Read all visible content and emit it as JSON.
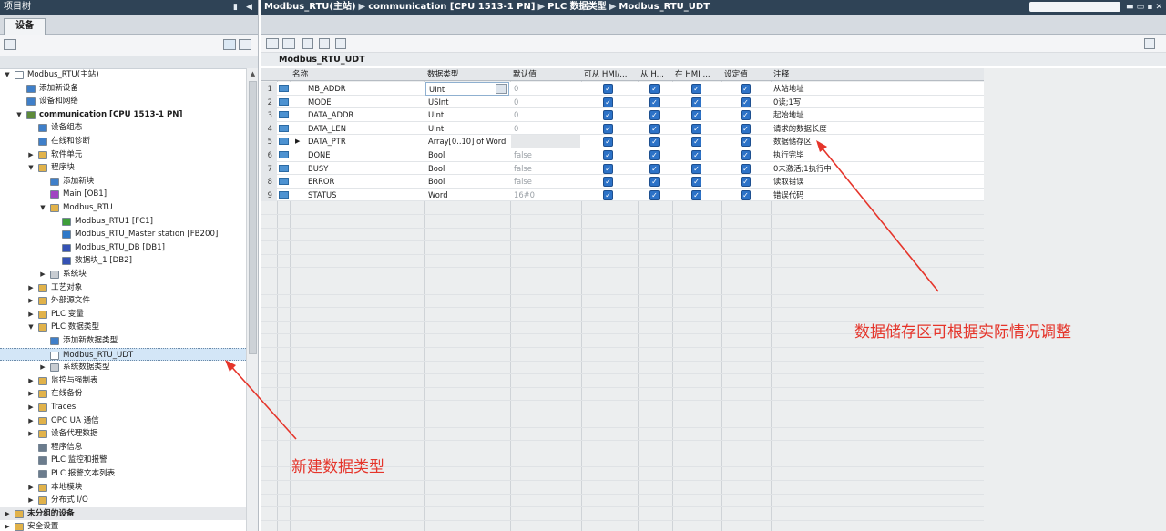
{
  "left_panel": {
    "title": "项目树",
    "tab": "设备"
  },
  "tree": [
    {
      "label": "Modbus_RTU(主站)",
      "level": 0,
      "arrow": "▼",
      "icon": "project-icon",
      "color": "#ffffff"
    },
    {
      "label": "添加新设备",
      "level": 1,
      "arrow": "",
      "icon": "add-device-icon",
      "color": "#3f7fc9"
    },
    {
      "label": "设备和网络",
      "level": 1,
      "arrow": "",
      "icon": "network-icon",
      "color": "#3f7fc9"
    },
    {
      "label": "communication [CPU 1513-1 PN]",
      "level": 1,
      "arrow": "▼",
      "icon": "cpu-icon",
      "color": "#5d8a3a",
      "bold": true
    },
    {
      "label": "设备组态",
      "level": 2,
      "arrow": "",
      "icon": "config-icon",
      "color": "#3f7fc9"
    },
    {
      "label": "在线和诊断",
      "level": 2,
      "arrow": "",
      "icon": "diagnostics-icon",
      "color": "#3f7fc9"
    },
    {
      "label": "软件单元",
      "level": 2,
      "arrow": "▶",
      "icon": "folder-icon",
      "color": "#e1b24a"
    },
    {
      "label": "程序块",
      "level": 2,
      "arrow": "▼",
      "icon": "folder-icon",
      "color": "#e1b24a"
    },
    {
      "label": "添加新块",
      "level": 3,
      "arrow": "",
      "icon": "add-block-icon",
      "color": "#3f7fc9"
    },
    {
      "label": "Main [OB1]",
      "level": 3,
      "arrow": "",
      "icon": "ob-icon",
      "color": "#a044c2"
    },
    {
      "label": "Modbus_RTU",
      "level": 3,
      "arrow": "▼",
      "icon": "folder-icon",
      "color": "#e1b24a"
    },
    {
      "label": "Modbus_RTU1 [FC1]",
      "level": 4,
      "arrow": "",
      "icon": "fc-icon",
      "color": "#3e9e3a"
    },
    {
      "label": "Modbus_RTU_Master station [FB200]",
      "level": 4,
      "arrow": "",
      "icon": "fb-icon",
      "color": "#2e78c8"
    },
    {
      "label": "Modbus_RTU_DB [DB1]",
      "level": 4,
      "arrow": "",
      "icon": "db-icon",
      "color": "#3552b5"
    },
    {
      "label": "数据块_1 [DB2]",
      "level": 4,
      "arrow": "",
      "icon": "db-icon",
      "color": "#3552b5"
    },
    {
      "label": "系统块",
      "level": 3,
      "arrow": "▶",
      "icon": "folder-icon",
      "color": "#c7ccd2"
    },
    {
      "label": "工艺对象",
      "level": 2,
      "arrow": "▶",
      "icon": "folder-icon",
      "color": "#e1b24a"
    },
    {
      "label": "外部源文件",
      "level": 2,
      "arrow": "▶",
      "icon": "folder-icon",
      "color": "#e1b24a"
    },
    {
      "label": "PLC 变量",
      "level": 2,
      "arrow": "▶",
      "icon": "folder-icon",
      "color": "#e1b24a"
    },
    {
      "label": "PLC 数据类型",
      "level": 2,
      "arrow": "▼",
      "icon": "folder-icon",
      "color": "#e1b24a"
    },
    {
      "label": "添加新数据类型",
      "level": 3,
      "arrow": "",
      "icon": "add-type-icon",
      "color": "#3f7fc9"
    },
    {
      "label": "Modbus_RTU_UDT",
      "level": 3,
      "arrow": "",
      "icon": "udt-icon",
      "color": "#ffffff",
      "selected": true
    },
    {
      "label": "系统数据类型",
      "level": 3,
      "arrow": "▶",
      "icon": "folder-icon",
      "color": "#c7ccd2"
    },
    {
      "label": "监控与强制表",
      "level": 2,
      "arrow": "▶",
      "icon": "folder-icon",
      "color": "#e1b24a"
    },
    {
      "label": "在线备份",
      "level": 2,
      "arrow": "▶",
      "icon": "folder-icon",
      "color": "#e1b24a"
    },
    {
      "label": "Traces",
      "level": 2,
      "arrow": "▶",
      "icon": "folder-icon",
      "color": "#e1b24a"
    },
    {
      "label": "OPC UA 通信",
      "level": 2,
      "arrow": "▶",
      "icon": "folder-icon",
      "color": "#e1b24a"
    },
    {
      "label": "设备代理数据",
      "level": 2,
      "arrow": "▶",
      "icon": "folder-icon",
      "color": "#e1b24a"
    },
    {
      "label": "程序信息",
      "level": 2,
      "arrow": "",
      "icon": "info-icon",
      "color": "#6b7c8d"
    },
    {
      "label": "PLC 监控和报警",
      "level": 2,
      "arrow": "",
      "icon": "alarm-icon",
      "color": "#6b7c8d"
    },
    {
      "label": "PLC 报警文本列表",
      "level": 2,
      "arrow": "",
      "icon": "text-list-icon",
      "color": "#6b7c8d"
    },
    {
      "label": "本地模块",
      "level": 2,
      "arrow": "▶",
      "icon": "folder-icon",
      "color": "#e1b24a"
    },
    {
      "label": "分布式 I/O",
      "level": 2,
      "arrow": "▶",
      "icon": "folder-icon",
      "color": "#e1b24a"
    },
    {
      "label": "未分组的设备",
      "level": 0,
      "arrow": "▶",
      "icon": "folder-icon",
      "color": "#e1b24a",
      "bold": true,
      "gray": true
    },
    {
      "label": "安全设置",
      "level": 0,
      "arrow": "▶",
      "icon": "folder-icon",
      "color": "#e1b24a"
    }
  ],
  "breadcrumb": [
    "Modbus_RTU(主站)",
    "communication [CPU 1513-1 PN]",
    "PLC 数据类型",
    "Modbus_RTU_UDT"
  ],
  "editor": {
    "udt_name": "Modbus_RTU_UDT",
    "columns": [
      "名称",
      "数据类型",
      "默认值",
      "可从 HMI/...",
      "从 H...",
      "在 HMI ...",
      "设定值",
      "注释"
    ],
    "rows": [
      {
        "num": "1",
        "name": "MB_ADDR",
        "type": "UInt",
        "default": "0",
        "hmi1": true,
        "hmi2": true,
        "hmi3": true,
        "setpoint": true,
        "comment": "从站地址",
        "editing": true
      },
      {
        "num": "2",
        "name": "MODE",
        "type": "USInt",
        "default": "0",
        "hmi1": true,
        "hmi2": true,
        "hmi3": true,
        "setpoint": true,
        "comment": "0读;1写"
      },
      {
        "num": "3",
        "name": "DATA_ADDR",
        "type": "UInt",
        "default": "0",
        "hmi1": true,
        "hmi2": true,
        "hmi3": true,
        "setpoint": true,
        "comment": "起始地址"
      },
      {
        "num": "4",
        "name": "DATA_LEN",
        "type": "UInt",
        "default": "0",
        "hmi1": true,
        "hmi2": true,
        "hmi3": true,
        "setpoint": true,
        "comment": "请求的数据长度"
      },
      {
        "num": "5",
        "name": "DATA_PTR",
        "type": "Array[0..10] of Word",
        "default": "",
        "hmi1": true,
        "hmi2": true,
        "hmi3": true,
        "setpoint": true,
        "comment": "数据储存区",
        "expandable": true
      },
      {
        "num": "6",
        "name": "DONE",
        "type": "Bool",
        "default": "false",
        "hmi1": true,
        "hmi2": true,
        "hmi3": true,
        "setpoint": true,
        "comment": "执行完毕"
      },
      {
        "num": "7",
        "name": "BUSY",
        "type": "Bool",
        "default": "false",
        "hmi1": true,
        "hmi2": true,
        "hmi3": true,
        "setpoint": true,
        "comment": "0未激活;1执行中"
      },
      {
        "num": "8",
        "name": "ERROR",
        "type": "Bool",
        "default": "false",
        "hmi1": true,
        "hmi2": true,
        "hmi3": true,
        "setpoint": true,
        "comment": "读取错误"
      },
      {
        "num": "9",
        "name": "STATUS",
        "type": "Word",
        "default": "16#0",
        "hmi1": true,
        "hmi2": true,
        "hmi3": true,
        "setpoint": true,
        "comment": "错误代码"
      }
    ]
  },
  "annotations": {
    "right": "数据储存区可根据实际情况调整",
    "left": "新建数据类型",
    "color": "#e5352b"
  }
}
